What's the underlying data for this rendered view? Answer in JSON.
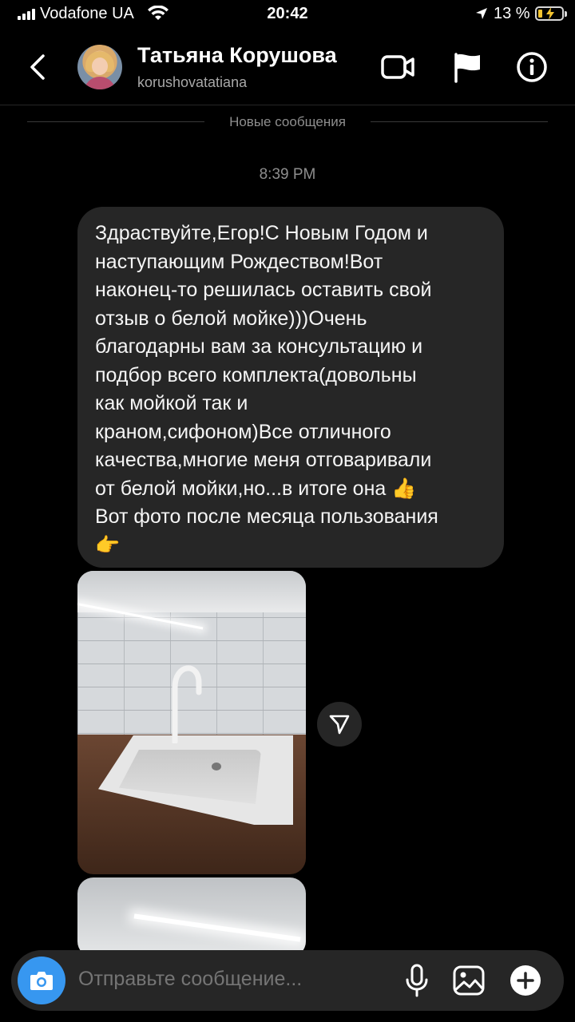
{
  "status_bar": {
    "carrier": "Vodafone UA",
    "time": "20:42",
    "battery_percent": "13 %",
    "signal_bars": 4,
    "charging": true
  },
  "header": {
    "contact_name": "Татьяна Корушова",
    "contact_username": "korushovatatiana",
    "icons": [
      "back-icon",
      "video-call-icon",
      "flag-icon",
      "info-icon"
    ]
  },
  "thread": {
    "new_messages_label": "Новые сообщения",
    "timestamp": "8:39 PM",
    "message_text": "Здраствуйте,Егор!С Новым Годом и\nнаступающим Рождеством!Вот\nнаконец-то решилась оставить свой\nотзыв о белой мойке)))Очень\nблагодарны вам за консультацию и\nподбор всего комплекта(довольны\nкак мойкой так и\nкраном,сифоном)Все отличного\nкачества,многие меня отговаривали\nот белой мойки,но...в итоге она 👍\nВот фото после месяца пользования\n👉"
  },
  "composer": {
    "placeholder": "Отправьте сообщение...",
    "icons": [
      "camera-icon",
      "microphone-icon",
      "gallery-icon",
      "plus-icon"
    ]
  },
  "colors": {
    "background": "#000000",
    "bubble": "#262626",
    "accent_blue": "#3797f0",
    "secondary_text": "#8e8e8e",
    "battery_fill": "#f4c430"
  }
}
